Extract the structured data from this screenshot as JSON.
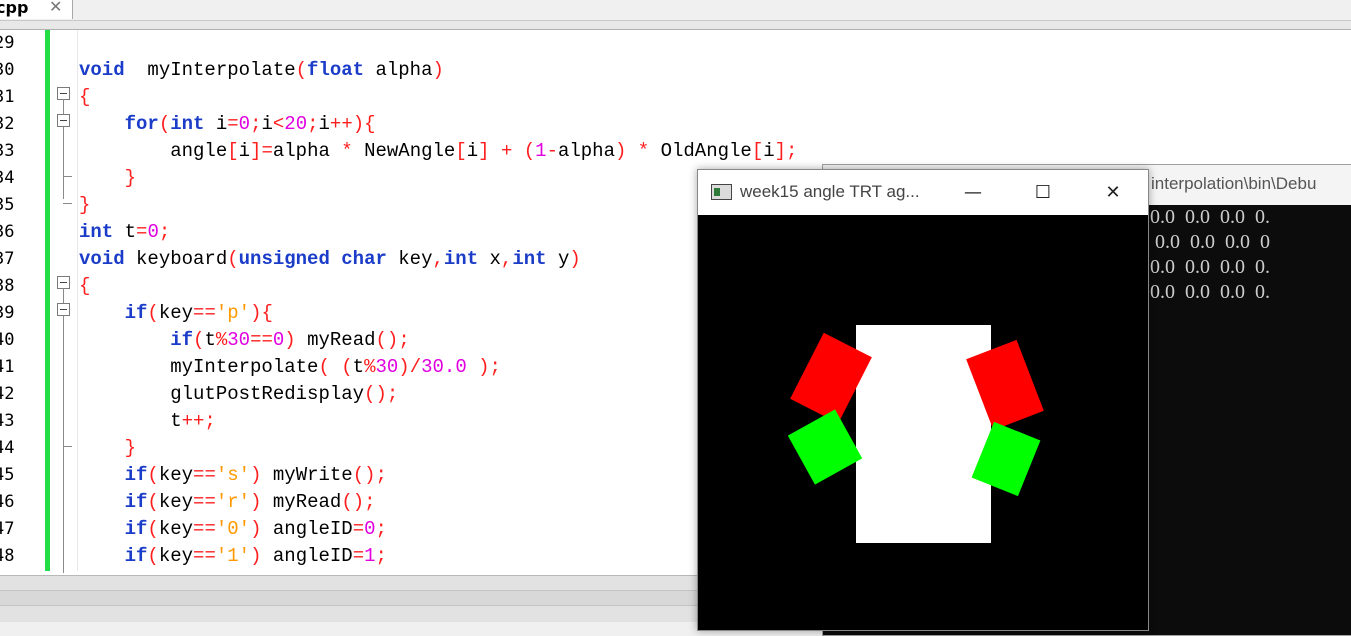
{
  "editor": {
    "tab": {
      "label": "cpp",
      "close": "✕"
    },
    "line_numbers": [
      "29",
      "30",
      "31",
      "32",
      "33",
      "34",
      "35",
      "36",
      "37",
      "38",
      "39",
      "40",
      "41",
      "42",
      "43",
      "44",
      "45",
      "46",
      "47",
      "48"
    ],
    "lines": [
      [],
      [
        [
          "kw",
          "void"
        ],
        [
          "",
          "  myInterpolate"
        ],
        [
          "pn",
          "("
        ],
        [
          "kw",
          "float"
        ],
        [
          "",
          " alpha"
        ],
        [
          "pn",
          ")"
        ]
      ],
      [
        [
          "pn",
          "{"
        ]
      ],
      [
        [
          "",
          "    "
        ],
        [
          "kw",
          "for"
        ],
        [
          "pn",
          "("
        ],
        [
          "kw",
          "int"
        ],
        [
          "",
          " i"
        ],
        [
          "pn",
          "="
        ],
        [
          "nm",
          "0"
        ],
        [
          "pn",
          ";"
        ],
        [
          "",
          "i"
        ],
        [
          "pn",
          "<"
        ],
        [
          "nm",
          "20"
        ],
        [
          "pn",
          ";"
        ],
        [
          "",
          "i"
        ],
        [
          "pn",
          "++){"
        ]
      ],
      [
        [
          "",
          "        angle"
        ],
        [
          "pn",
          "["
        ],
        [
          "",
          "i"
        ],
        [
          "pn",
          "]="
        ],
        [
          "",
          "alpha "
        ],
        [
          "pn",
          "*"
        ],
        [
          "",
          " NewAngle"
        ],
        [
          "pn",
          "["
        ],
        [
          "",
          "i"
        ],
        [
          "pn",
          "]"
        ],
        [
          "",
          " "
        ],
        [
          "pn",
          "+"
        ],
        [
          "",
          " "
        ],
        [
          "pn",
          "("
        ],
        [
          "nm",
          "1"
        ],
        [
          "pn",
          "-"
        ],
        [
          "",
          "alpha"
        ],
        [
          "pn",
          ")"
        ],
        [
          "",
          " "
        ],
        [
          "pn",
          "*"
        ],
        [
          "",
          " OldAngle"
        ],
        [
          "pn",
          "["
        ],
        [
          "",
          "i"
        ],
        [
          "pn",
          "];"
        ]
      ],
      [
        [
          "",
          "    "
        ],
        [
          "pn",
          "}"
        ]
      ],
      [
        [
          "pn",
          "}"
        ]
      ],
      [
        [
          "kw",
          "int"
        ],
        [
          "",
          " t"
        ],
        [
          "pn",
          "="
        ],
        [
          "nm",
          "0"
        ],
        [
          "pn",
          ";"
        ]
      ],
      [
        [
          "kw",
          "void"
        ],
        [
          "",
          " keyboard"
        ],
        [
          "pn",
          "("
        ],
        [
          "kw",
          "unsigned"
        ],
        [
          "",
          " "
        ],
        [
          "kw",
          "char"
        ],
        [
          "",
          " key"
        ],
        [
          "pn",
          ","
        ],
        [
          "kw",
          "int"
        ],
        [
          "",
          " x"
        ],
        [
          "pn",
          ","
        ],
        [
          "kw",
          "int"
        ],
        [
          "",
          " y"
        ],
        [
          "pn",
          ")"
        ]
      ],
      [
        [
          "pn",
          "{"
        ]
      ],
      [
        [
          "",
          "    "
        ],
        [
          "kw",
          "if"
        ],
        [
          "pn",
          "("
        ],
        [
          "",
          "key"
        ],
        [
          "pn",
          "=="
        ],
        [
          "st",
          "'p'"
        ],
        [
          "pn",
          "){"
        ]
      ],
      [
        [
          "",
          "        "
        ],
        [
          "kw",
          "if"
        ],
        [
          "pn",
          "("
        ],
        [
          "",
          "t"
        ],
        [
          "pn",
          "%"
        ],
        [
          "nm",
          "30"
        ],
        [
          "pn",
          "=="
        ],
        [
          "nm",
          "0"
        ],
        [
          "pn",
          ")"
        ],
        [
          "",
          " myRead"
        ],
        [
          "pn",
          "();"
        ]
      ],
      [
        [
          "",
          "        myInterpolate"
        ],
        [
          "pn",
          "("
        ],
        [
          "",
          " "
        ],
        [
          "pn",
          "("
        ],
        [
          "",
          "t"
        ],
        [
          "pn",
          "%"
        ],
        [
          "nm",
          "30"
        ],
        [
          "pn",
          ")/"
        ],
        [
          "nm",
          "30.0"
        ],
        [
          "",
          " "
        ],
        [
          "pn",
          ");"
        ]
      ],
      [
        [
          "",
          "        glutPostRedisplay"
        ],
        [
          "pn",
          "();"
        ]
      ],
      [
        [
          "",
          "        t"
        ],
        [
          "pn",
          "++;"
        ]
      ],
      [
        [
          "",
          "    "
        ],
        [
          "pn",
          "}"
        ]
      ],
      [
        [
          "",
          "    "
        ],
        [
          "kw",
          "if"
        ],
        [
          "pn",
          "("
        ],
        [
          "",
          "key"
        ],
        [
          "pn",
          "=="
        ],
        [
          "st",
          "'s'"
        ],
        [
          "pn",
          ")"
        ],
        [
          "",
          " myWrite"
        ],
        [
          "pn",
          "();"
        ]
      ],
      [
        [
          "",
          "    "
        ],
        [
          "kw",
          "if"
        ],
        [
          "pn",
          "("
        ],
        [
          "",
          "key"
        ],
        [
          "pn",
          "=="
        ],
        [
          "st",
          "'r'"
        ],
        [
          "pn",
          ")"
        ],
        [
          "",
          " myRead"
        ],
        [
          "pn",
          "();"
        ]
      ],
      [
        [
          "",
          "    "
        ],
        [
          "kw",
          "if"
        ],
        [
          "pn",
          "("
        ],
        [
          "",
          "key"
        ],
        [
          "pn",
          "=="
        ],
        [
          "st",
          "'0'"
        ],
        [
          "pn",
          ")"
        ],
        [
          "",
          " angleID"
        ],
        [
          "pn",
          "="
        ],
        [
          "nm",
          "0"
        ],
        [
          "pn",
          ";"
        ]
      ],
      [
        [
          "",
          "    "
        ],
        [
          "kw",
          "if"
        ],
        [
          "pn",
          "("
        ],
        [
          "",
          "key"
        ],
        [
          "pn",
          "=="
        ],
        [
          "st",
          "'1'"
        ],
        [
          "pn",
          ")"
        ],
        [
          "",
          " angleID"
        ],
        [
          "pn",
          "="
        ],
        [
          "nm",
          "1"
        ],
        [
          "pn",
          ";"
        ]
      ]
    ],
    "colors": {
      "keyword": "#1a3cc8",
      "punctuation": "#ff1e1e",
      "number": "#e000e0",
      "string": "#ff9900",
      "change_bar": "#22dd44"
    }
  },
  "console_window": {
    "title": "interpolation\\bin\\Debu",
    "lines": [
      "0.0  0.0  0.0  0.",
      " 0.0  0.0  0.0  0",
      "0.0  0.0  0.0  0.",
      "0.0  0.0  0.0  0."
    ]
  },
  "glut_window": {
    "title": "week15 angle TRT ag...",
    "minimize": "—",
    "maximize": "☐",
    "close": "✕",
    "scene_colors": {
      "background": "#000000",
      "body": "#ffffff",
      "upper_arm": "#ff0000",
      "lower_arm": "#00ff00"
    }
  }
}
